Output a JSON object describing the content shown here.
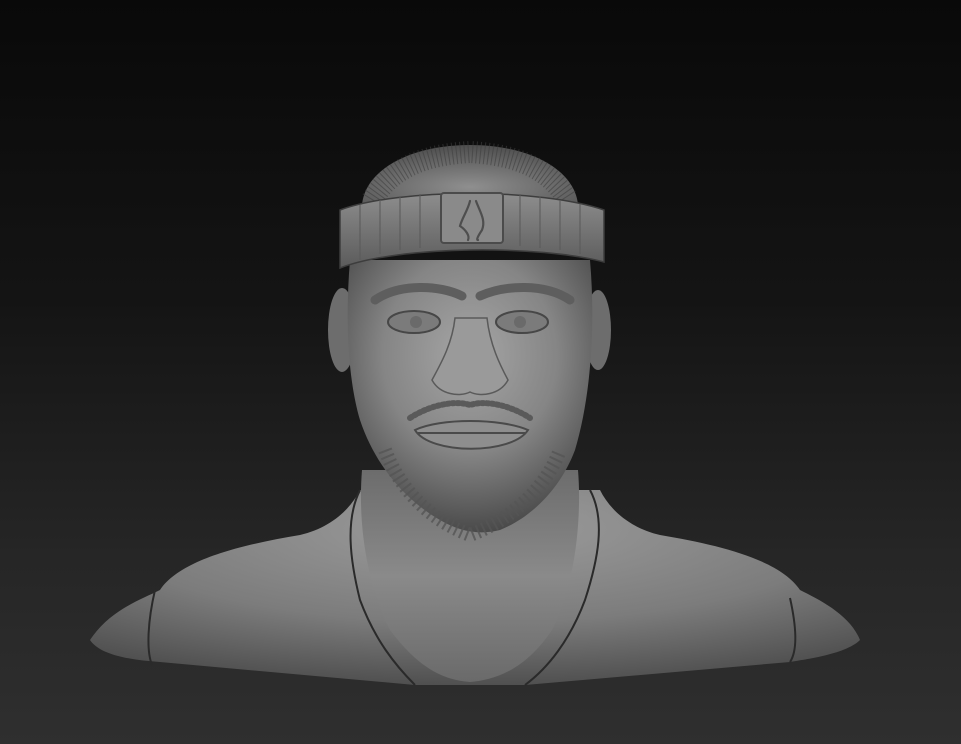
{
  "viewport": {
    "background_top": "#090909",
    "background_bottom": "#2f2f2f",
    "model_material_color": "#8a8a8a",
    "model_type": "clay-render-bust",
    "headwear": "knit-beanie",
    "beanie_emblem": "logo-emblem"
  }
}
